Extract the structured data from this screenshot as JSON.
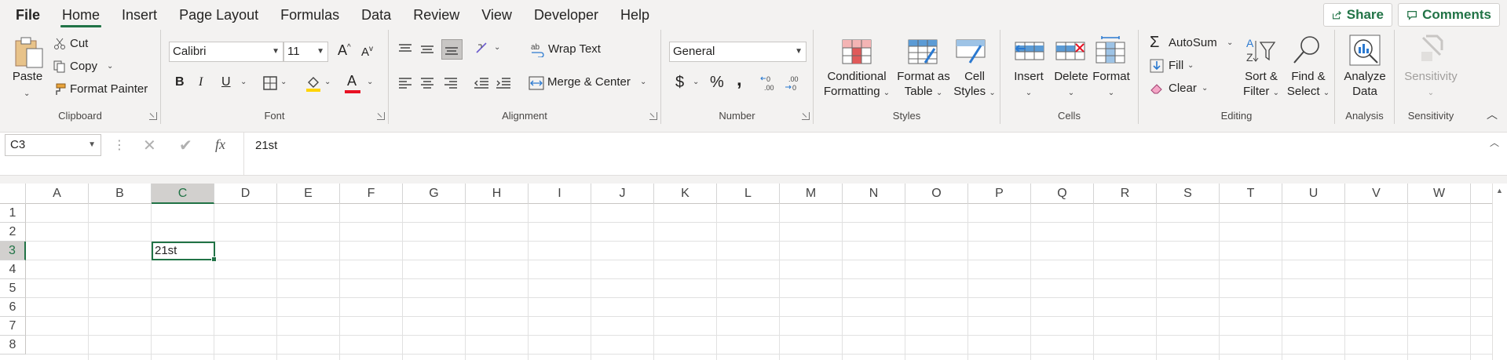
{
  "tabs": [
    {
      "label": "File"
    },
    {
      "label": "Home"
    },
    {
      "label": "Insert"
    },
    {
      "label": "Page Layout"
    },
    {
      "label": "Formulas"
    },
    {
      "label": "Data"
    },
    {
      "label": "Review"
    },
    {
      "label": "View"
    },
    {
      "label": "Developer"
    },
    {
      "label": "Help"
    }
  ],
  "top": {
    "share": "Share",
    "comments": "Comments"
  },
  "clipboard": {
    "paste": "Paste",
    "cut": "Cut",
    "copy": "Copy",
    "format_painter": "Format Painter",
    "label": "Clipboard"
  },
  "font": {
    "name": "Calibri",
    "size": "11",
    "bold": "B",
    "italic": "I",
    "underline": "U",
    "label": "Font",
    "grow": "A",
    "shrink": "A",
    "color_letter": "A"
  },
  "alignment": {
    "wrap": "Wrap Text",
    "merge": "Merge & Center",
    "label": "Alignment"
  },
  "number": {
    "format": "General",
    "currency": "$",
    "percent": "%",
    "comma": ",",
    "label": "Number"
  },
  "styles": {
    "conditional_1": "Conditional",
    "conditional_2": "Formatting",
    "format_table_1": "Format as",
    "format_table_2": "Table",
    "cell_styles_1": "Cell",
    "cell_styles_2": "Styles",
    "label": "Styles"
  },
  "cells": {
    "insert": "Insert",
    "delete": "Delete",
    "format": "Format",
    "label": "Cells"
  },
  "editing": {
    "autosum": "AutoSum",
    "fill": "Fill",
    "clear": "Clear",
    "sort_1": "Sort &",
    "sort_2": "Filter",
    "find_1": "Find &",
    "find_2": "Select",
    "label": "Editing"
  },
  "analysis": {
    "analyze_1": "Analyze",
    "analyze_2": "Data",
    "label": "Analysis"
  },
  "sensitivity": {
    "button": "Sensitivity",
    "label": "Sensitivity"
  },
  "formula_bar": {
    "name_box": "C3",
    "formula": "21st",
    "fx": "fx"
  },
  "columns": [
    "A",
    "B",
    "C",
    "D",
    "E",
    "F",
    "G",
    "H",
    "I",
    "J",
    "K",
    "L",
    "M",
    "N",
    "O",
    "P",
    "Q",
    "R",
    "S",
    "T",
    "U",
    "V",
    "W"
  ],
  "rows": [
    "1",
    "2",
    "3",
    "4",
    "5",
    "6",
    "7",
    "8"
  ],
  "active_cell": {
    "ref": "C3",
    "value": "21st"
  },
  "colors": {
    "accent": "#217346",
    "ribbon_bg": "#f3f2f1"
  }
}
